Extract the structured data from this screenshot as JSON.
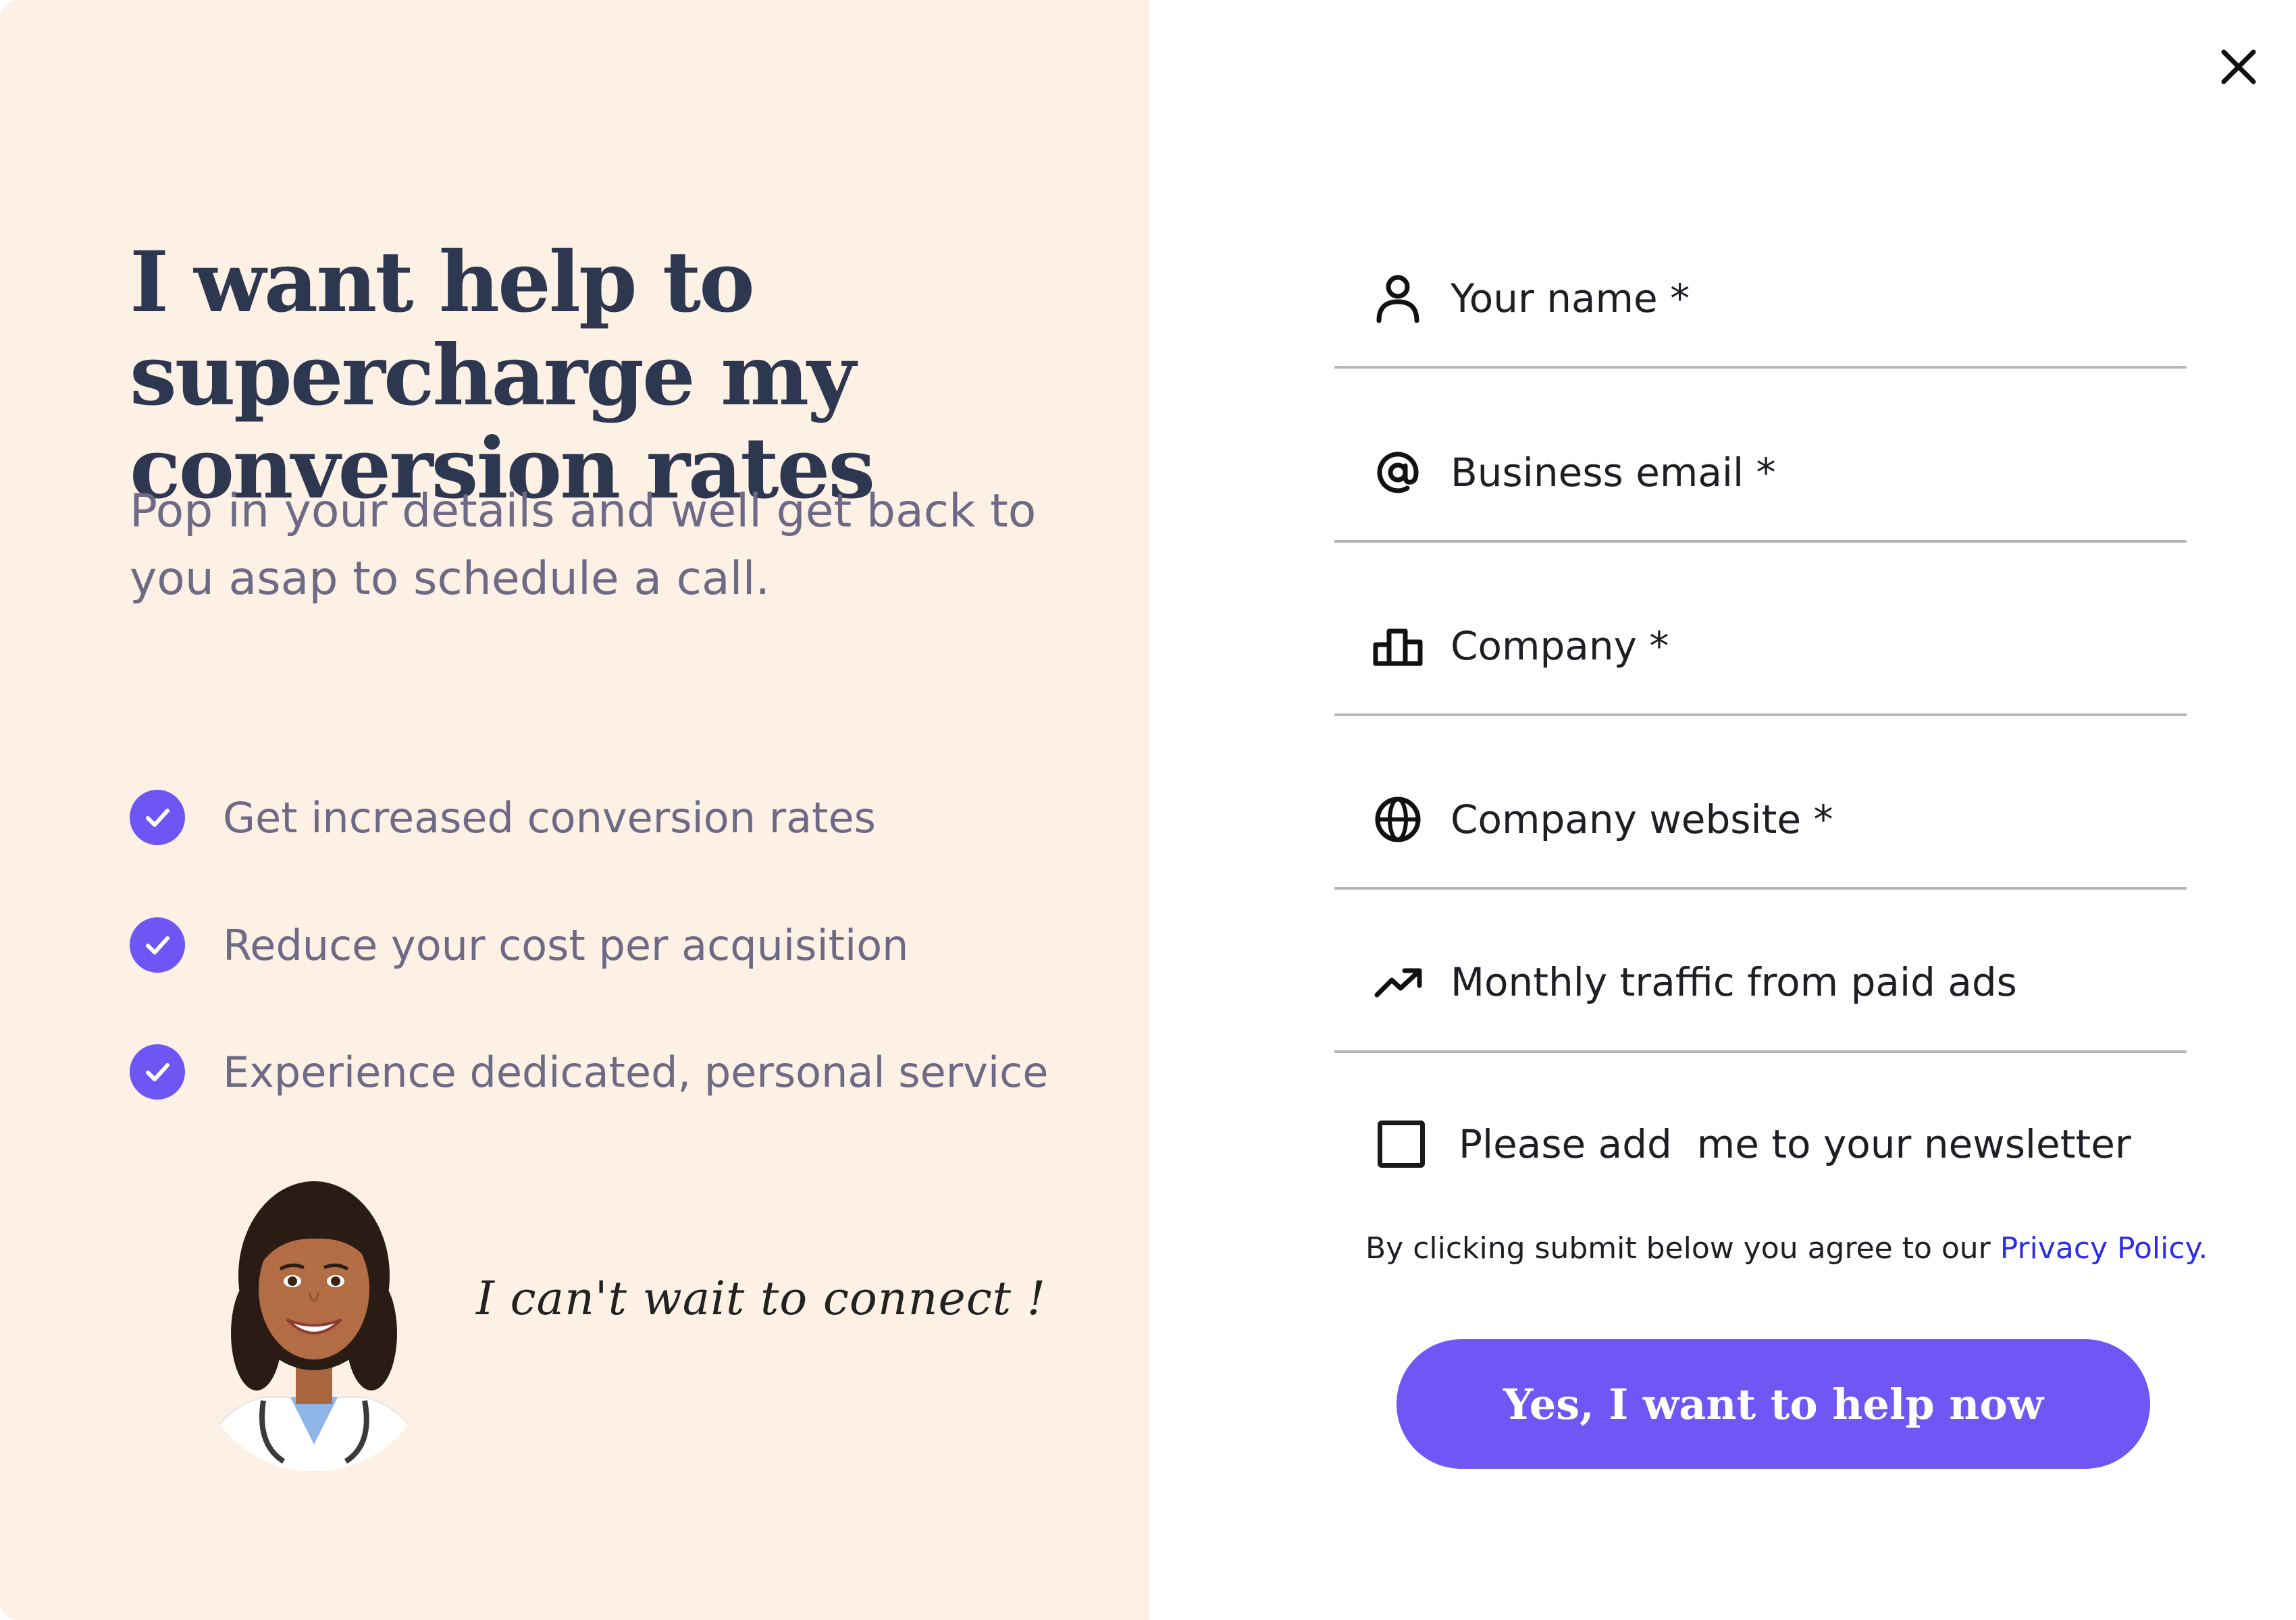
{
  "left": {
    "headline": "I want help to supercharge my conversion rates",
    "subhead": "Pop in your details and well get back to you asap to schedule a call.",
    "benefits": [
      "Get increased conversion rates",
      "Reduce your cost per acquisition",
      "Experience dedicated, personal service"
    ],
    "quote": "I can't wait to connect !"
  },
  "form": {
    "fields": [
      {
        "label": "Your name *",
        "icon": "person-icon"
      },
      {
        "label": "Business email *",
        "icon": "at-sign-icon"
      },
      {
        "label": "Company *",
        "icon": "building-icon"
      },
      {
        "label": "Company website *",
        "icon": "globe-icon"
      },
      {
        "label": "Monthly traffic from paid ads",
        "icon": "trending-up-icon"
      }
    ],
    "newsletter_label": "Please add  me to your newsletter",
    "newsletter_checked": false,
    "consent_text": "By clicking submit below you agree to our ",
    "privacy_link": "Privacy Policy.",
    "submit_label": "Yes, I want to help now"
  },
  "colors": {
    "left_panel_bg": "#fdf1e5",
    "accent": "#7056f5",
    "headline": "#2e3750",
    "body_text": "#6e6a86",
    "link": "#2b2ee8"
  }
}
